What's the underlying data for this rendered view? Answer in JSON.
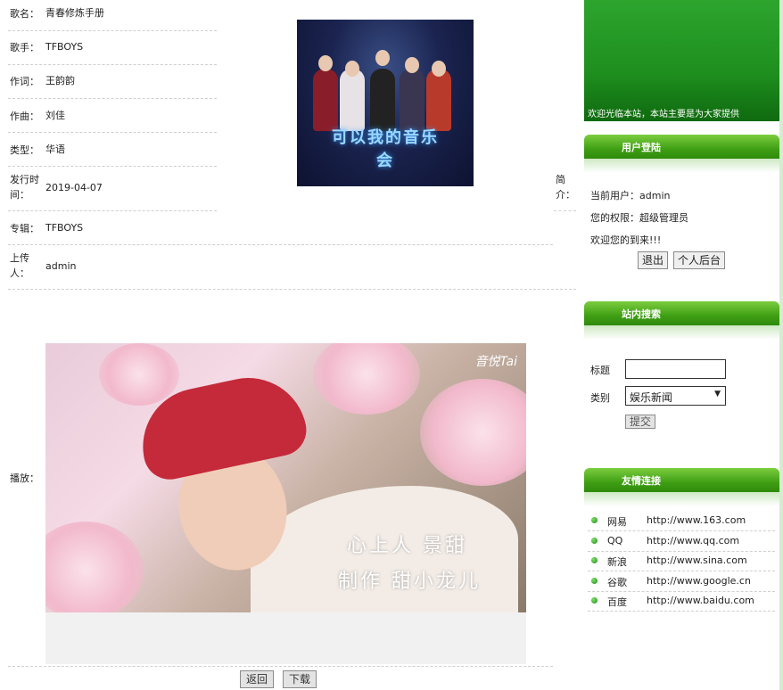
{
  "song": {
    "fields": [
      {
        "label": "歌名：",
        "value": "青春修炼手册"
      },
      {
        "label": "歌手：",
        "value": "TFBOYS"
      },
      {
        "label": "作词：",
        "value": "王韵韵"
      },
      {
        "label": "作曲：",
        "value": "刘佳"
      },
      {
        "label": "类型：",
        "value": "华语"
      },
      {
        "label": "发行时间：",
        "value": "2019-04-07"
      },
      {
        "label": "专辑：",
        "value": "TFBOYS"
      },
      {
        "label": "上传人：",
        "value": "admin"
      }
    ],
    "intro_label": "简介：",
    "cover_title": "可以我的音乐会",
    "play_label": "播放：",
    "video_watermark": "音悦Tai",
    "video_caption_1": "心上人 景甜",
    "video_caption_2": "制作 甜小龙儿",
    "back_button": "返回",
    "download_button": "下载"
  },
  "sidebar": {
    "banner_ticker": "欢迎光临本站，本站主要是为大家提供",
    "login": {
      "title": "用户登陆",
      "current_user": "当前用户：admin",
      "permission": "您的权限：超级管理员",
      "welcome": "欢迎您的到来!!!",
      "logout_button": "退出",
      "backend_button": "个人后台"
    },
    "search": {
      "title": "站内搜索",
      "title_label": "标题",
      "title_value": "",
      "category_label": "类别",
      "category_selected": "娱乐新闻",
      "submit_button": "提交"
    },
    "links": {
      "title": "友情连接",
      "items": [
        {
          "name": "网易",
          "url": "http://www.163.com"
        },
        {
          "name": "QQ",
          "url": "http://www.qq.com"
        },
        {
          "name": "新浪",
          "url": "http://www.sina.com"
        },
        {
          "name": "谷歌",
          "url": "http://www.google.cn"
        },
        {
          "name": "百度",
          "url": "http://www.baidu.com"
        }
      ]
    }
  }
}
